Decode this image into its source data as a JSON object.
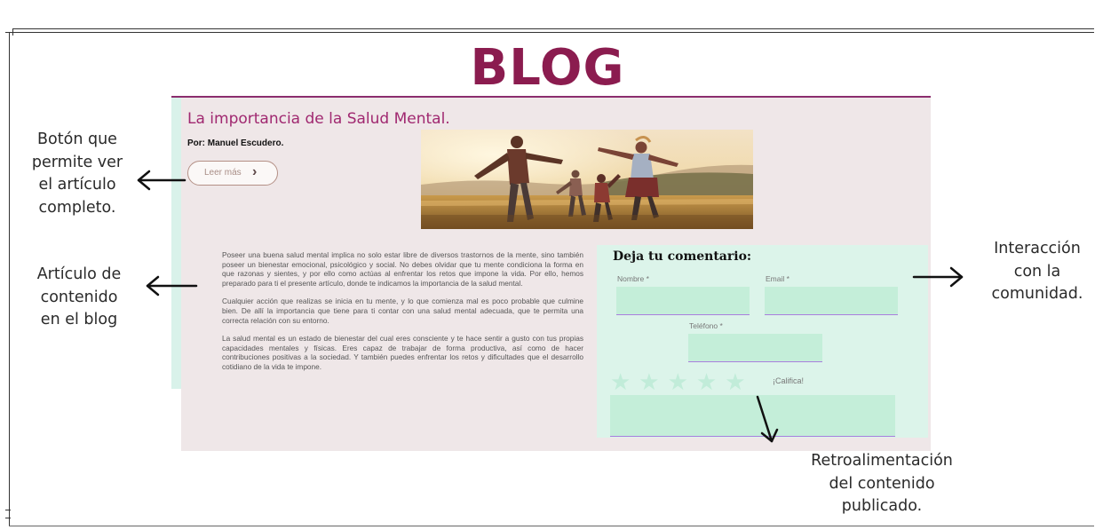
{
  "header": {
    "title": "BLOG"
  },
  "post": {
    "title": "La importancia de la Salud Mental.",
    "author": "Por: Manuel Escudero.",
    "read_more_label": "Leer más",
    "paragraphs": [
      "Poseer una buena salud mental implica no solo estar libre de diversos trastornos de la mente, sino también poseer un  bienestar emocional, psicológico y social. No debes olvidar que tu mente condiciona la forma en que razonas y sientes, y por ello como actúas al enfrentar los retos que impone la vida. Por ello, hemos preparado para ti el presente artículo, donde te indicamos la importancia de la salud mental.",
      "Cualquier acción que realizas se inicia en tu mente, y lo que comienza mal es poco probable que culmine bien. De allí la importancia que tiene para ti contar con una salud mental adecuada, que te permita una correcta relación con su entorno.",
      "La salud mental es un estado de bienestar  del cual eres consciente y te hace sentir a gusto con tus propias capacidades mentales y físicas. Eres capaz de trabajar de forma productiva, así como de hacer contribuciones positivas a la sociedad. Y también puedes enfrentar los retos y dificultades que el desarrollo cotidiano de la vida te impone."
    ]
  },
  "comment_form": {
    "title": "Deja tu comentario:",
    "name_label": "Nombre *",
    "email_label": "Email *",
    "phone_label": "Teléfono *",
    "rate_label": "¡Califica!",
    "stars_display": "★★★★★",
    "star_color": "#c1ecd9"
  },
  "annotations": {
    "read_more": [
      "Botón que",
      "permite ver",
      "el artículo",
      "completo."
    ],
    "content": [
      "Artículo de",
      "contenido",
      "en el blog"
    ],
    "community": [
      "Interacción",
      "con la",
      "comunidad."
    ],
    "feedback": [
      "Retroalimentación",
      "del contenido",
      "publicado."
    ]
  },
  "colors": {
    "brand": "#8b1c4f",
    "post_title": "#a02870",
    "card_bg": "#efe7e8",
    "form_bg": "#dcf4ea",
    "field_bg": "#c4eed9",
    "field_underline": "#a97fdd"
  },
  "icons": {
    "read_more": "chevron-right-icon"
  }
}
